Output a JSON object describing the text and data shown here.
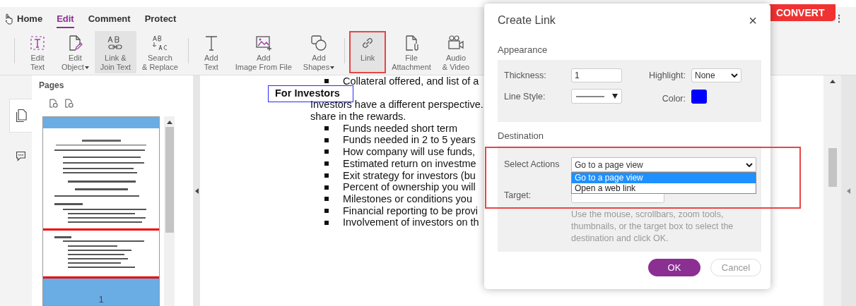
{
  "tabs": [
    {
      "label": "Home",
      "selected": false
    },
    {
      "label": "Edit",
      "selected": true
    },
    {
      "label": "Comment",
      "selected": false
    },
    {
      "label": "Protect",
      "selected": false
    }
  ],
  "toolbar": [
    {
      "kind": "edit-text",
      "lines": [
        "Edit",
        "Text"
      ],
      "dropdown": false,
      "selected": false,
      "highlighted": false,
      "separator_before": true
    },
    {
      "kind": "edit-object",
      "lines": [
        "Edit",
        "Object"
      ],
      "dropdown": true,
      "selected": false,
      "highlighted": false,
      "separator_before": false
    },
    {
      "kind": "link-join",
      "lines": [
        "Link &",
        "Join Text"
      ],
      "dropdown": false,
      "selected": true,
      "highlighted": false,
      "separator_before": false
    },
    {
      "kind": "search-replace",
      "lines": [
        "Search",
        "& Replace"
      ],
      "dropdown": false,
      "selected": false,
      "highlighted": false,
      "separator_before": false
    },
    {
      "kind": "add-text",
      "lines": [
        "Add",
        "Text"
      ],
      "dropdown": false,
      "selected": false,
      "highlighted": false,
      "separator_before": true
    },
    {
      "kind": "add-image",
      "lines": [
        "Add",
        "Image From File"
      ],
      "dropdown": false,
      "selected": false,
      "highlighted": false,
      "separator_before": false
    },
    {
      "kind": "add-shapes",
      "lines": [
        "Add",
        "Shapes"
      ],
      "dropdown": true,
      "selected": false,
      "highlighted": false,
      "separator_before": false
    },
    {
      "kind": "link",
      "lines": [
        "Link"
      ],
      "dropdown": false,
      "selected": true,
      "highlighted": true,
      "separator_before": true
    },
    {
      "kind": "file-attachment",
      "lines": [
        "File",
        "Attachment"
      ],
      "dropdown": false,
      "selected": false,
      "highlighted": false,
      "separator_before": false
    },
    {
      "kind": "audio-video",
      "lines": [
        "Audio",
        "& Video"
      ],
      "dropdown": false,
      "selected": false,
      "highlighted": false,
      "separator_before": false
    }
  ],
  "convert_button": {
    "label": "CONVERT"
  },
  "more_menu": "⋮",
  "sidebar": {
    "items": [
      {
        "kind": "pages",
        "selected": true
      },
      {
        "kind": "comments",
        "selected": false
      }
    ],
    "panel_title": "Pages",
    "page_number": "1"
  },
  "document": {
    "lines": [
      {
        "kind": "bullet",
        "text": "Collateral offered, and list of a"
      },
      {
        "kind": "heading",
        "text": "For Investors"
      },
      {
        "kind": "paragraph",
        "text": "Investors have a different perspective."
      },
      {
        "kind": "paragraph",
        "text": "share in the rewards."
      },
      {
        "kind": "bullet",
        "text": "Funds needed short term"
      },
      {
        "kind": "bullet",
        "text": "Funds needed in 2 to 5 years"
      },
      {
        "kind": "bullet",
        "text": "How company will use funds,"
      },
      {
        "kind": "bullet",
        "text": "Estimated return on investme"
      },
      {
        "kind": "bullet",
        "text": "Exit strategy for investors (bu"
      },
      {
        "kind": "bullet",
        "text": "Percent of ownership you will"
      },
      {
        "kind": "bullet",
        "text": "Milestones or conditions you"
      },
      {
        "kind": "bullet",
        "text": "Financial reporting to be provi"
      },
      {
        "kind": "bullet",
        "text": "Involvement of investors on th"
      }
    ]
  },
  "dialog": {
    "title": "Create Link",
    "close": "×",
    "appearance": {
      "label": "Appearance",
      "thickness": {
        "label": "Thickness:",
        "value": "1"
      },
      "highlight": {
        "label": "Highlight:",
        "value": "None"
      },
      "line_style": {
        "label": "Line Style:"
      },
      "color": {
        "label": "Color:",
        "color": "#0000ff"
      }
    },
    "destination": {
      "label": "Destination",
      "highlighted": true,
      "select_actions": {
        "label": "Select Actions",
        "value": "Go to a page view",
        "expanded": true,
        "options": [
          {
            "label": "Go to a page view",
            "selected": true
          },
          {
            "label": "Open a web link",
            "selected": false
          }
        ]
      },
      "target": {
        "label": "Target:"
      },
      "hint": "Use the mouse, scrollbars, zoom tools, thumbnails, or the target box to select the destination and click OK."
    },
    "buttons": [
      {
        "kind": "primary",
        "label": "OK"
      },
      {
        "kind": "secondary",
        "label": "Cancel"
      }
    ]
  }
}
